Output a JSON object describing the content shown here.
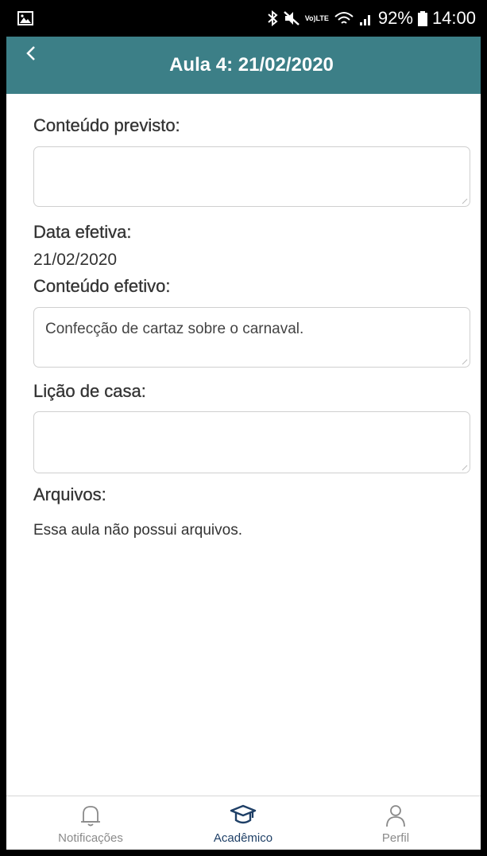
{
  "status_bar": {
    "network_badge": [
      "Vo)",
      "LTE"
    ],
    "battery": "92%",
    "time": "14:00"
  },
  "header": {
    "title": "Aula 4: 21/02/2020",
    "color": "#3c7f87"
  },
  "fields": {
    "conteudo_previsto": {
      "label": "Conteúdo previsto:",
      "value": ""
    },
    "data_efetiva": {
      "label": "Data efetiva:",
      "value": "21/02/2020"
    },
    "conteudo_efetivo": {
      "label": "Conteúdo efetivo:",
      "value": "Confecção de cartaz sobre o carnaval."
    },
    "licao_de_casa": {
      "label": "Lição de casa:",
      "value": ""
    },
    "arquivos": {
      "label": "Arquivos:",
      "empty_message": "Essa aula não possui arquivos."
    }
  },
  "bottom_nav": {
    "items": [
      {
        "label": "Notificações",
        "icon": "bell-icon",
        "active": false
      },
      {
        "label": "Acadêmico",
        "icon": "graduation-cap-icon",
        "active": true
      },
      {
        "label": "Perfil",
        "icon": "person-icon",
        "active": false
      }
    ],
    "active_color": "#1e3f66",
    "inactive_color": "#8a8a8a"
  }
}
